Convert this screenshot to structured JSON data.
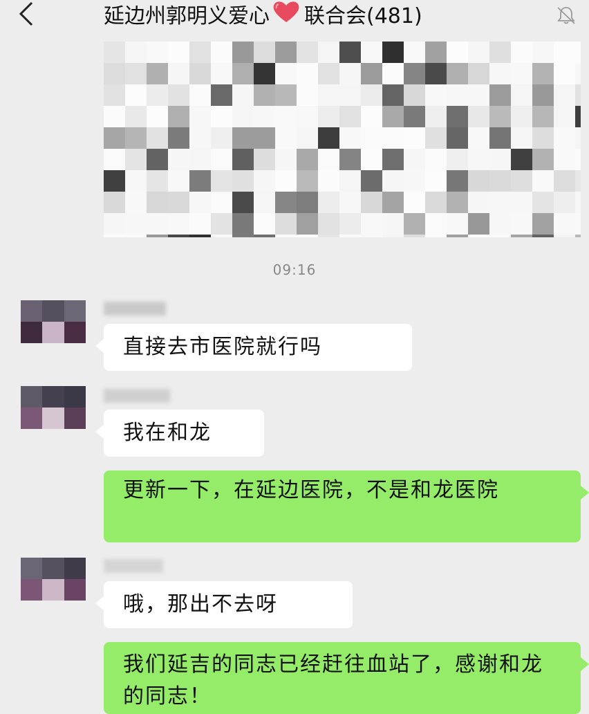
{
  "header": {
    "title_prefix": "延边州郭明义爱心",
    "title_suffix": "联合会(481)",
    "back_icon": "chevron-left-icon",
    "mute_icon": "bell-muted-icon",
    "heart_color": "#e84a5f"
  },
  "chat": {
    "timestamp": "09:16",
    "messages": [
      {
        "direction": "incoming",
        "text": "直接去市医院就行吗"
      },
      {
        "direction": "incoming",
        "text": "我在和龙"
      },
      {
        "direction": "outgoing",
        "text": "更新一下，在延边医院，不是和龙医院"
      },
      {
        "direction": "incoming",
        "text": "哦，那出不去呀"
      },
      {
        "direction": "outgoing",
        "text": "我们延吉的同志已经赶往血站了，感谢和龙的同志！"
      }
    ]
  },
  "colors": {
    "background": "#ededed",
    "incoming_bubble": "#ffffff",
    "outgoing_bubble": "#95ec69"
  }
}
